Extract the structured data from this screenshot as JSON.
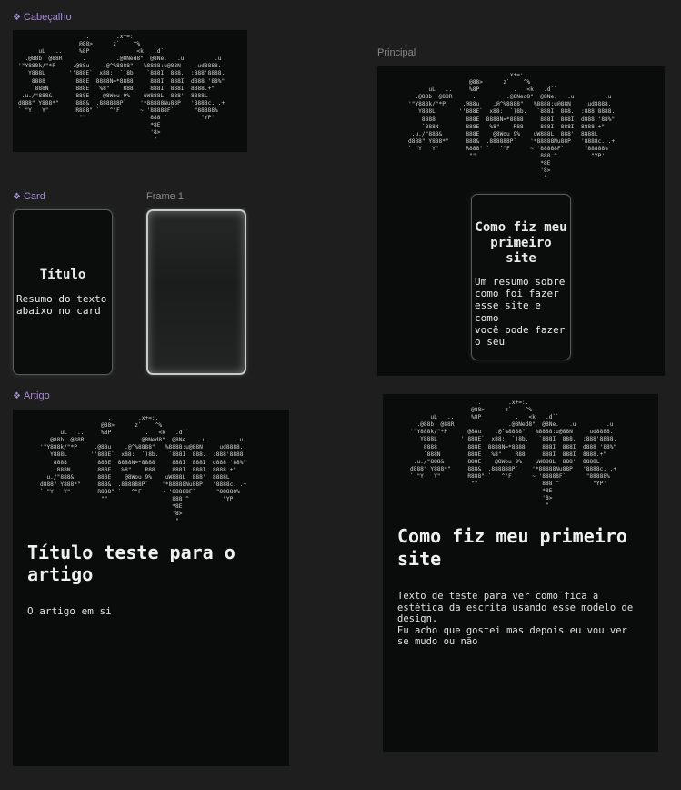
{
  "labels": {
    "cabecalho": "Cabeçalho",
    "principal": "Principal",
    "card": "Card",
    "frame1": "Frame 1",
    "artigo": "Artigo"
  },
  "icons": {
    "component": "component-icon"
  },
  "colors": {
    "component_label": "#a78bd6",
    "frame_label": "#8a8a8a",
    "canvas": "#1e1e1e",
    "frame": "#0a0b0b"
  },
  "ascii_logo": "                    .        .x+=:.\n                  @88>      z`    ^%\n      uL   ..     %8P          .   <k   .d``\n  .@88b  @88R      .         .@8Ned8\"  @8Ne.   .u         .u\n'\"Y888k/\"*P     .@88u    .@^%8888\"   %8888:u@88N     ud8888.\n   Y888L       ''888E`  x88:  `)8b.   `888I  888.  :888'8888.\n    8888         888E  8888N=*8888     888I  888I  d888 '88%\"\n    `888N        888E   %8\"    R88     888I  888I  8888.+\"\n .u./\"888&       888E    @8Wou 9%    uW888L  888'  8888L\nd888\" Y888*\"     888&  .888888P`    '*88888Nu88P   '8888c. .+\n` \"Y   Y\"        R888\" `   ^\"F      ~ '88888F`      \"88888%\n                  \"\"                   888 ^          \"YP'\n                                       *8E\n                                       '8>\n                                        \"",
  "card": {
    "title": "Título",
    "body": "Resumo do texto\nabaixo no card"
  },
  "principal": {
    "card_title": "Como fiz meu\nprimeiro\nsite",
    "card_body": "Um resumo sobre\ncomo foi fazer\nesse site e como\nvocê pode fazer\no seu"
  },
  "artigo": {
    "title": "Título teste para o\nartigo",
    "body": "O artigo em si"
  },
  "post": {
    "title": "Como fiz meu primeiro\nsite",
    "body": "Texto de teste para ver como fica a\nestética da escrita usando esse modelo de\ndesign.\nEu acho que gostei mas depois eu vou ver\nse mudo ou não"
  }
}
